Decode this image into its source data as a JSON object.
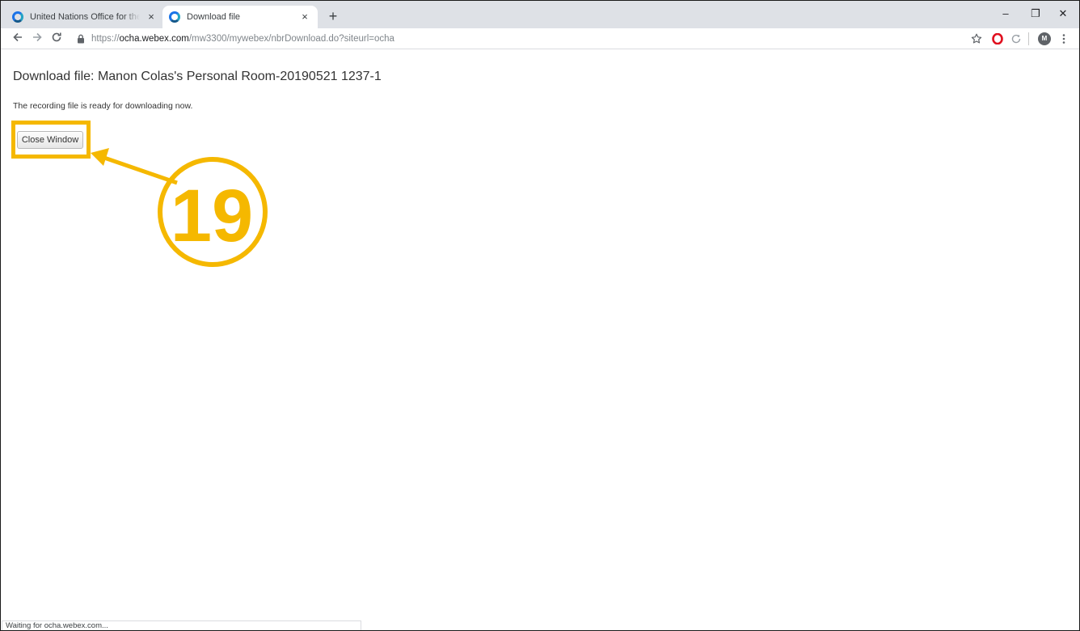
{
  "browser": {
    "tabs": [
      {
        "title": "United Nations Office for the Coo",
        "active": false
      },
      {
        "title": "Download file",
        "active": true
      }
    ],
    "tab_close_glyph": "×",
    "new_tab_glyph": "+",
    "window_controls": {
      "minimize": "–",
      "restore": "❐",
      "close": "✕"
    },
    "address": {
      "scheme": "https://",
      "host": "ocha.webex.com",
      "path": "/mw3300/mywebex/nbrDownload.do?siteurl=ocha"
    },
    "avatar_initial": "M",
    "colors": {
      "opera_red": "#e0101f",
      "favicon_blue": "#1a73e8"
    },
    "icons": [
      "back-arrow-icon",
      "forward-arrow-icon",
      "reload-icon",
      "lock-icon",
      "star-icon",
      "opera-icon",
      "extension-icon",
      "profile-avatar",
      "menu-dots-icon"
    ]
  },
  "page": {
    "title": "Download file: Manon Colas's Personal Room-20190521 1237-1",
    "message": "The recording file is ready for downloading now.",
    "close_button_label": "Close Window"
  },
  "annotation": {
    "step_number": "19",
    "color": "#f5b800"
  },
  "status_bar": {
    "text": "Waiting for ocha.webex.com..."
  }
}
